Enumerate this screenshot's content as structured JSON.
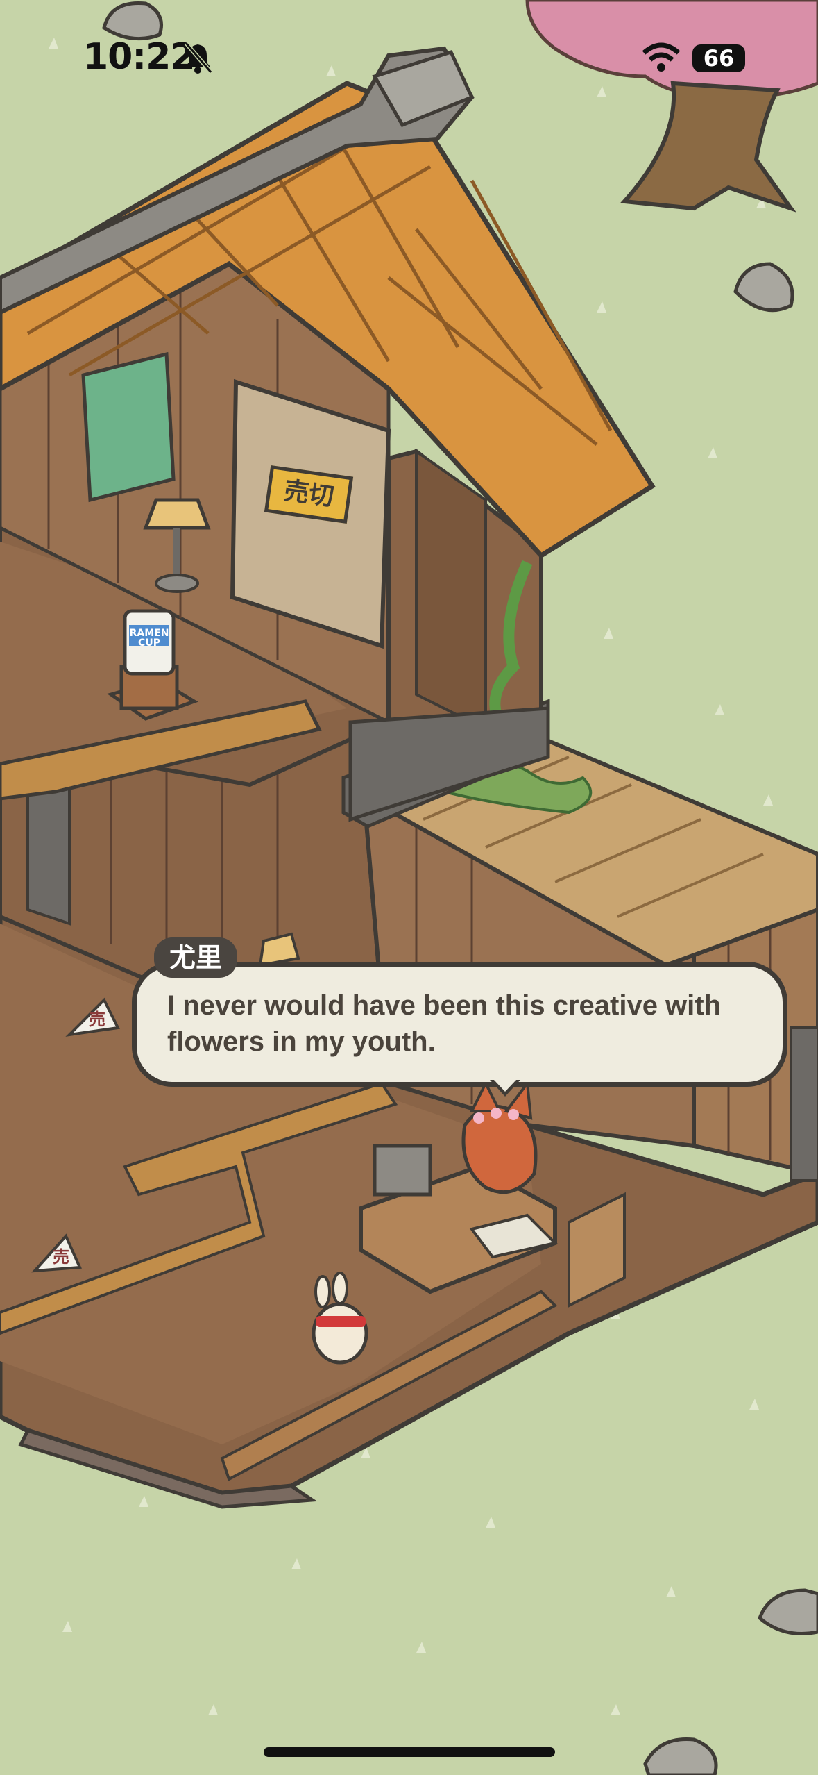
{
  "status_bar": {
    "time": "10:22",
    "battery": "66",
    "icons": [
      "bell-muted-icon",
      "wifi-icon",
      "battery-icon"
    ]
  },
  "dialogue": {
    "speaker": "尤里",
    "text": "I never would have been this creative with flowers in my youth."
  },
  "signs": {
    "shop_sign": "売切",
    "small_sign": "売"
  },
  "ramen_label": "RAMEN CUP",
  "colors": {
    "grass": "#c6d4a8",
    "roof_tile": "#d99440",
    "wood_floor": "#8a6447",
    "bubble_bg": "#efecdf",
    "outline": "#3f3b36",
    "cherry_blossom": "#d98fa8"
  }
}
